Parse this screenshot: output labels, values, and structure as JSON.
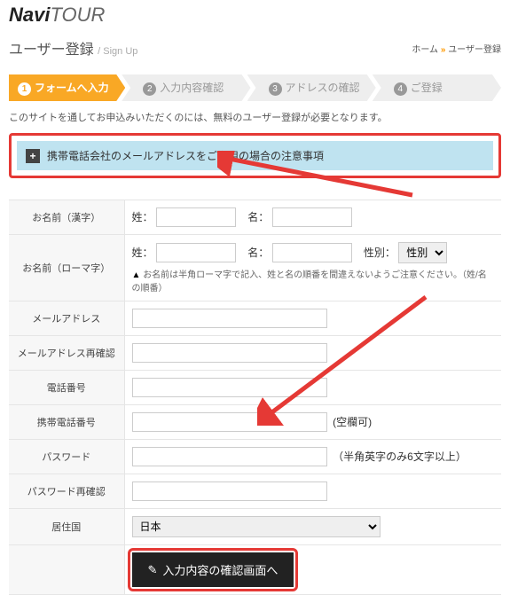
{
  "logo": {
    "part1": "Navi",
    "part2": "TOUR"
  },
  "page_title": {
    "main": "ユーザー登録",
    "sub": "/ Sign Up"
  },
  "breadcrumb": {
    "home": "ホーム",
    "sep": "»",
    "current": "ユーザー登録"
  },
  "steps": [
    {
      "num": "1",
      "label": "フォームへ入力"
    },
    {
      "num": "2",
      "label": "入力内容確認"
    },
    {
      "num": "3",
      "label": "アドレスの確認"
    },
    {
      "num": "4",
      "label": "ご登録"
    }
  ],
  "intro": "このサイトを通してお申込みいただくのには、無料のユーザー登録が必要となります。",
  "notice": {
    "text": "携帯電話会社のメールアドレスをご利用の場合の注意事項"
  },
  "form": {
    "name_kanji": {
      "label": "お名前（漢字）",
      "sei": "姓：",
      "mei": "名："
    },
    "name_roma": {
      "label": "お名前（ローマ字）",
      "sei": "姓：",
      "mei": "名：",
      "gender_label": "性別：",
      "gender_placeholder": "性別",
      "hint_icon": "▲",
      "hint": "お名前は半角ローマ字で記入、姓と名の順番を間違えないようご注意ください。（姓/名の順番）"
    },
    "email": {
      "label": "メールアドレス"
    },
    "email2": {
      "label": "メールアドレス再確認"
    },
    "tel": {
      "label": "電話番号"
    },
    "mobile": {
      "label": "携帯電話番号",
      "hint": "(空欄可)"
    },
    "password": {
      "label": "パスワード",
      "hint": "（半角英字のみ6文字以上）",
      "hint_prefix": "（半角英",
      "hint_suffix": "字のみ6文字以上）"
    },
    "password2": {
      "label": "パスワード再確認"
    },
    "country": {
      "label": "居住国",
      "value": "日本"
    }
  },
  "submit": {
    "label": "入力内容の確認画面へ"
  }
}
